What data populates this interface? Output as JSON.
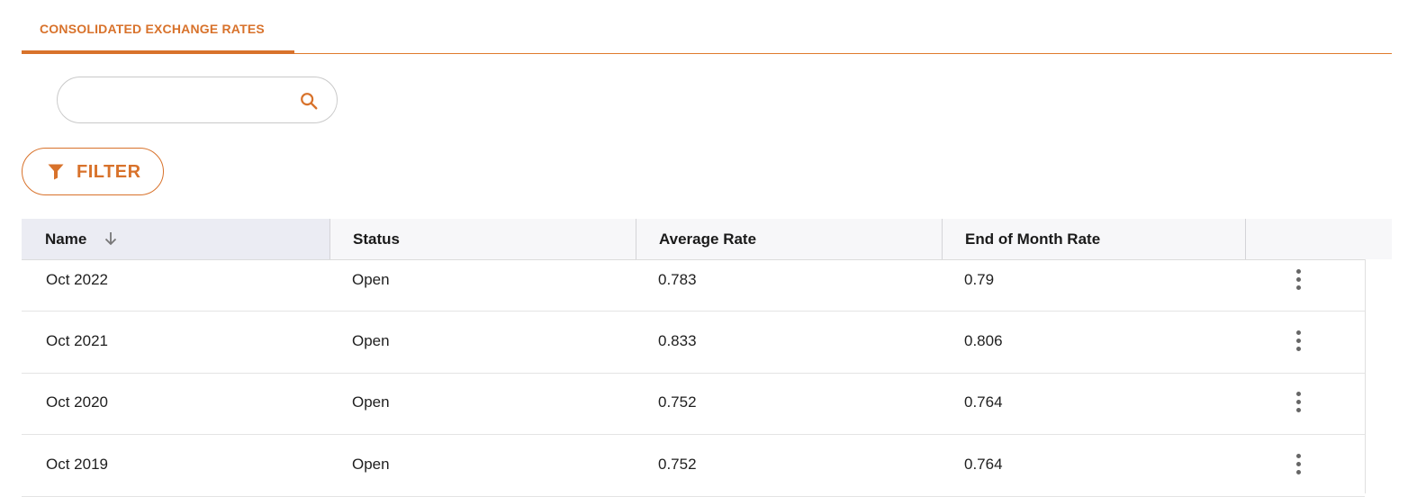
{
  "tabs": [
    {
      "label": "CONSOLIDATED EXCHANGE RATES",
      "active": true
    }
  ],
  "search": {
    "value": "",
    "placeholder": ""
  },
  "filter": {
    "label": "FILTER"
  },
  "table": {
    "columns": [
      "Name",
      "Status",
      "Average Rate",
      "End of Month Rate",
      ""
    ],
    "sort": {
      "column": "Name",
      "direction": "descending"
    },
    "rows": [
      {
        "name": "Oct 2022",
        "status": "Open",
        "average_rate": "0.783",
        "end_of_month_rate": "0.79"
      },
      {
        "name": "Oct 2021",
        "status": "Open",
        "average_rate": "0.833",
        "end_of_month_rate": "0.806"
      },
      {
        "name": "Oct 2020",
        "status": "Open",
        "average_rate": "0.752",
        "end_of_month_rate": "0.764"
      },
      {
        "name": "Oct 2019",
        "status": "Open",
        "average_rate": "0.752",
        "end_of_month_rate": "0.764"
      }
    ]
  },
  "icons": {
    "search": "search-icon",
    "filter": "filter-icon",
    "sort": "arrow-down-icon",
    "row_menu": "more-vertical-icon"
  },
  "colors": {
    "accent": "#d8722b",
    "header_bg": "#f7f7f9",
    "sorted_header_bg": "#ebecf3"
  }
}
